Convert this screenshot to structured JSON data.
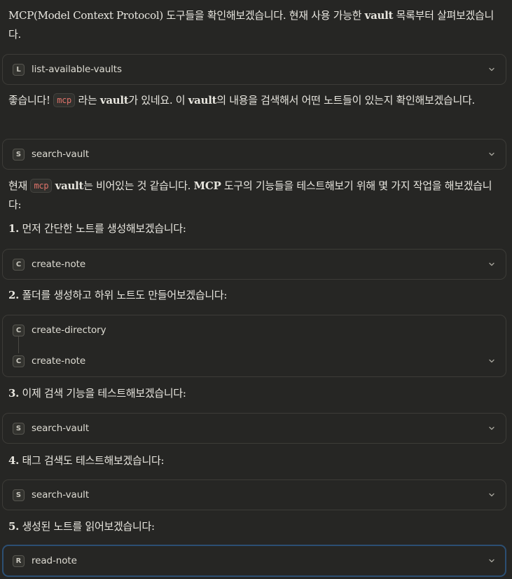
{
  "messages": [
    {
      "parts": [
        {
          "t": "text",
          "v": "MCP(Model Context Protocol) 도구들을 확인해보겠습니다. 현재 사용 가능한 "
        },
        {
          "t": "bold",
          "v": "vault"
        },
        {
          "t": "text",
          "v": " 목록부터 살펴보겠습니다."
        }
      ]
    },
    {
      "parts": [
        {
          "t": "text",
          "v": "좋습니다! "
        },
        {
          "t": "code",
          "v": "mcp"
        },
        {
          "t": "text",
          "v": " 라는 "
        },
        {
          "t": "bold",
          "v": "vault"
        },
        {
          "t": "text",
          "v": "가 있네요. 이 "
        },
        {
          "t": "bold",
          "v": "vault"
        },
        {
          "t": "text",
          "v": "의 내용을 검색해서 어떤 노트들이 있는지 확인해보겠습니다."
        }
      ]
    },
    {
      "parts": [
        {
          "t": "text",
          "v": "현재 "
        },
        {
          "t": "code",
          "v": "mcp"
        },
        {
          "t": "text",
          "v": " "
        },
        {
          "t": "bold",
          "v": "vault"
        },
        {
          "t": "text",
          "v": "는 비어있는 것 같습니다. "
        },
        {
          "t": "bold",
          "v": "MCP"
        },
        {
          "t": "text",
          "v": " 도구의 기능들을 테스트해보기 위해 몇 가지 작업을 해보겠습니다:"
        }
      ]
    },
    {
      "parts": [
        {
          "t": "bold",
          "v": "1."
        },
        {
          "t": "text",
          "v": " 먼저 간단한 노트를 생성해보겠습니다:"
        }
      ]
    },
    {
      "parts": [
        {
          "t": "bold",
          "v": "2."
        },
        {
          "t": "text",
          "v": " 폴더를 생성하고 하위 노트도 만들어보겠습니다:"
        }
      ]
    },
    {
      "parts": [
        {
          "t": "bold",
          "v": "3."
        },
        {
          "t": "text",
          "v": " 이제 검색 기능을 테스트해보겠습니다:"
        }
      ]
    },
    {
      "parts": [
        {
          "t": "bold",
          "v": "4."
        },
        {
          "t": "text",
          "v": " 태그 검색도 테스트해보겠습니다:"
        }
      ]
    },
    {
      "parts": [
        {
          "t": "bold",
          "v": "5."
        },
        {
          "t": "text",
          "v": " 생성된 노트를 읽어보겠습니다:"
        }
      ]
    }
  ],
  "tools": [
    {
      "letter": "L",
      "name": "list-available-vaults"
    },
    {
      "letter": "S",
      "name": "search-vault"
    },
    {
      "letter": "C",
      "name": "create-note"
    },
    {
      "letter": "C",
      "name": "create-directory"
    },
    {
      "letter": "C",
      "name": "create-note"
    },
    {
      "letter": "S",
      "name": "search-vault"
    },
    {
      "letter": "S",
      "name": "search-vault"
    },
    {
      "letter": "R",
      "name": "read-note"
    }
  ],
  "colors": {
    "background": "#262624",
    "code_text": "#e0736a",
    "active_border": "#2c4f73"
  },
  "icons": {
    "expand": "chevron-down-icon"
  }
}
